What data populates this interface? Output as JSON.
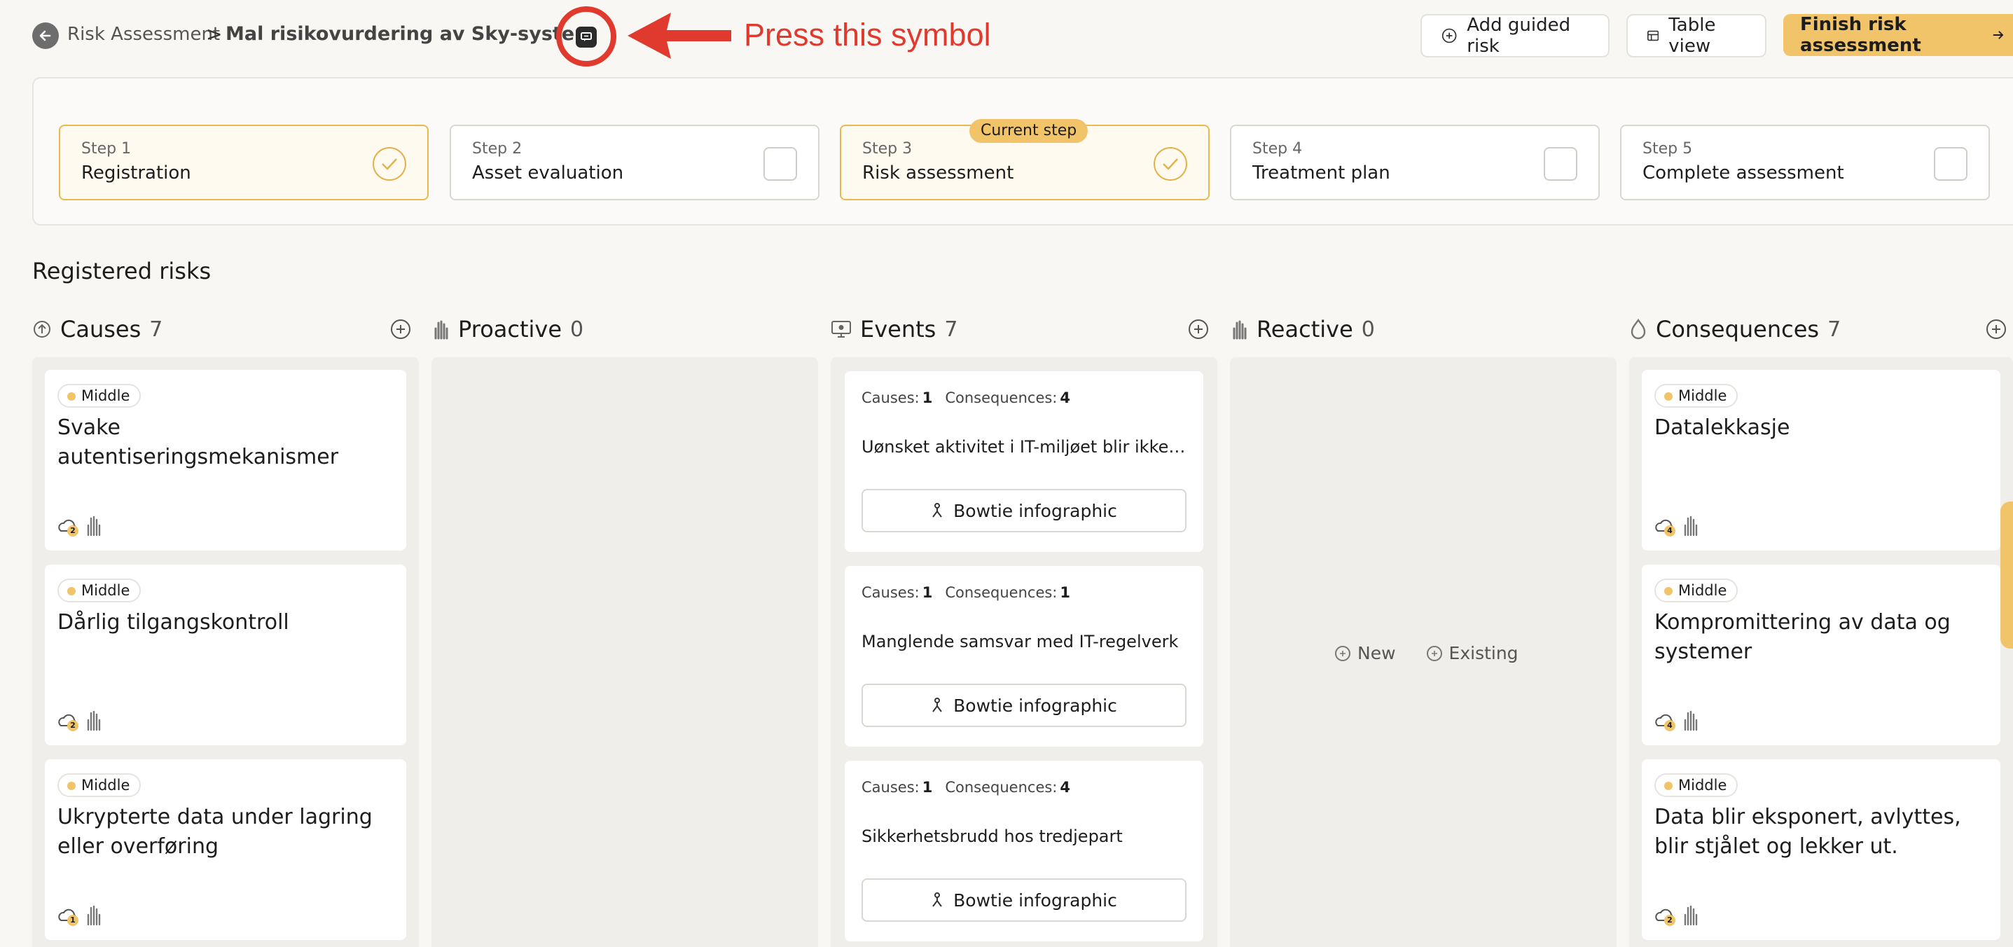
{
  "breadcrumb": {
    "back_icon": "arrow-left-icon",
    "parent": "Risk Assessment",
    "separator": ">",
    "current": "Mal risikovurdering av Sky-system"
  },
  "annotation": {
    "text": "Press this symbol",
    "color": "#e03a2e",
    "target_icon": "chat-icon"
  },
  "toolbar": {
    "guided_label": "Add guided risk",
    "table_label": "Table view",
    "finish_label": "Finish risk assessment"
  },
  "steps": [
    {
      "num": "Step 1",
      "name": "Registration",
      "state": "done"
    },
    {
      "num": "Step 2",
      "name": "Asset evaluation",
      "state": "todo"
    },
    {
      "num": "Step 3",
      "name": "Risk assessment",
      "state": "done",
      "badge": "Current step"
    },
    {
      "num": "Step 4",
      "name": "Treatment plan",
      "state": "todo"
    },
    {
      "num": "Step 5",
      "name": "Complete assessment",
      "state": "todo"
    }
  ],
  "section_title": "Registered risks",
  "columns": [
    {
      "title": "Causes",
      "count": "7",
      "icon": "cause-icon"
    },
    {
      "title": "Proactive",
      "count": "0",
      "icon": "hand-icon"
    },
    {
      "title": "Events",
      "count": "7",
      "icon": "monitor-icon"
    },
    {
      "title": "Reactive",
      "count": "0",
      "icon": "hand-icon"
    },
    {
      "title": "Consequences",
      "count": "7",
      "icon": "consequence-icon"
    }
  ],
  "causes": [
    {
      "level": "Middle",
      "title": "Svake autentiseringsmekanismer",
      "badge": "2"
    },
    {
      "level": "Middle",
      "title": "Dårlig tilgangskontroll",
      "badge": "2"
    },
    {
      "level": "Middle",
      "title": "Ukrypterte data under lagring eller overføring",
      "badge": "1"
    }
  ],
  "events": [
    {
      "causes_label": "Causes:",
      "causes": "1",
      "cons_label": "Consequences:",
      "cons": "4",
      "title": "Uønsket aktivitet i IT-miljøet blir ikke op...",
      "button": "Bowtie infographic"
    },
    {
      "causes_label": "Causes:",
      "causes": "1",
      "cons_label": "Consequences:",
      "cons": "1",
      "title": "Manglende samsvar med IT-regelverk",
      "button": "Bowtie infographic"
    },
    {
      "causes_label": "Causes:",
      "causes": "1",
      "cons_label": "Consequences:",
      "cons": "4",
      "title": "Sikkerhetsbrudd hos tredjepart",
      "button": "Bowtie infographic"
    }
  ],
  "reactive": {
    "new_label": "New",
    "existing_label": "Existing"
  },
  "consequences": [
    {
      "level": "Middle",
      "title": "Datalekkasje",
      "badge": "4"
    },
    {
      "level": "Middle",
      "title": "Kompromittering av data og systemer",
      "badge": "4"
    },
    {
      "level": "Middle",
      "title": "Data blir eksponert, avlyttes, blir stjålet og lekker ut.",
      "badge": "2"
    }
  ],
  "colors": {
    "accent": "#f1c46a",
    "accent_border": "#e8b94e",
    "annotation": "#e03a2e"
  }
}
